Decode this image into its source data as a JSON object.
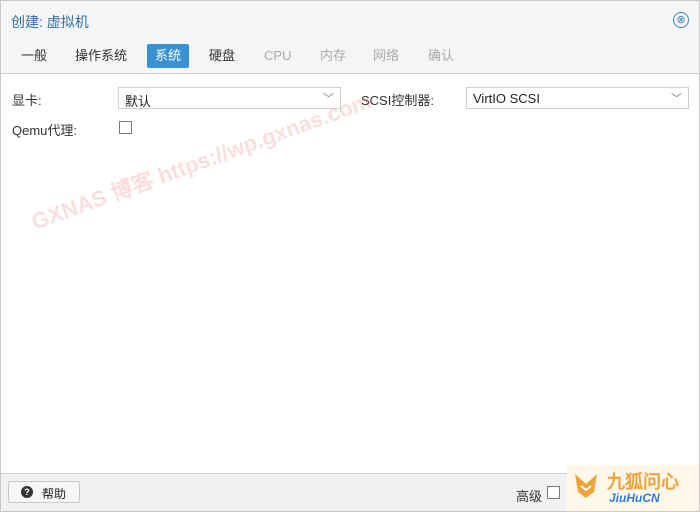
{
  "dialog": {
    "title": "创建: 虚拟机",
    "close_icon": "⊗"
  },
  "tabs": [
    {
      "label": "一般",
      "state": "normal"
    },
    {
      "label": "操作系统",
      "state": "normal"
    },
    {
      "label": "系统",
      "state": "active"
    },
    {
      "label": "硬盘",
      "state": "normal"
    },
    {
      "label": "CPU",
      "state": "disabled"
    },
    {
      "label": "内存",
      "state": "disabled"
    },
    {
      "label": "网络",
      "state": "disabled"
    },
    {
      "label": "确认",
      "state": "disabled"
    }
  ],
  "form": {
    "graphics_label": "显卡:",
    "graphics_value": "默认",
    "scsi_label": "SCSI控制器:",
    "scsi_value": "VirtIO SCSI",
    "qemu_agent_label": "Qemu代理:",
    "qemu_agent_checked": false
  },
  "footer": {
    "help_label": "帮助",
    "help_icon": "?",
    "advanced_label": "高级",
    "advanced_checked": false
  },
  "watermark": {
    "text": "GXNAS 博客 https://wp.gxnas.com"
  },
  "brand": {
    "name": "九狐问心",
    "sub": "JiuHuCN"
  },
  "colors": {
    "accent": "#3892d4",
    "title": "#2f6fa8",
    "brand_orange": "#f0a23a",
    "brand_blue": "#2d7bd2"
  }
}
